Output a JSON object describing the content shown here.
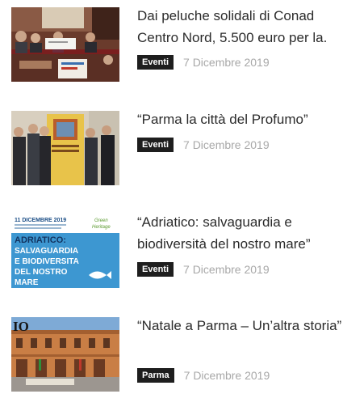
{
  "articles": [
    {
      "title": "Dai peluche solidali di Conad Centro Nord, 5.500 euro per la.",
      "category": "Eventi",
      "date": "7 Dicembre 2019",
      "thumb": "Presentazione assegno solidale"
    },
    {
      "title": "“Parma la città del Profumo”",
      "category": "Eventi",
      "date": "7 Dicembre 2019",
      "thumb": "Conferenza stampa Parma città del profumo"
    },
    {
      "title": "“Adriatico: salvaguardia e biodiversità del nostro mare”",
      "category": "Eventi",
      "date": "7 Dicembre 2019",
      "thumb": "Locandina Adriatico salvaguardia e biodiversità"
    },
    {
      "title": "“Natale a Parma – Un’altra storia”",
      "category": "Parma",
      "date": "7 Dicembre 2019",
      "thumb": "Piazza di Parma"
    }
  ],
  "poster": {
    "header_line": "11 DICEMBRE 2019",
    "brand_top": "Green",
    "brand_bottom": "Heritage",
    "title": "ADRIATICO:",
    "lines": [
      "SALVAGUARDIA",
      "E BIODIVERSITA",
      "DEL NOSTRO",
      "MARE"
    ]
  },
  "piazza_logo": "IO"
}
